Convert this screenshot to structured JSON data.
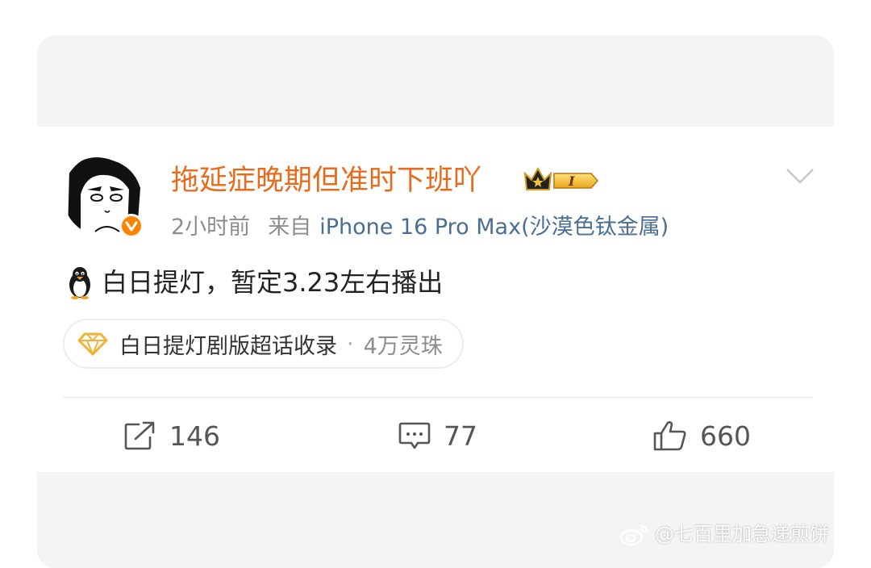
{
  "post": {
    "username": "拖延症晚期但准时下班吖",
    "vip_badge": "I",
    "time": "2小时前",
    "source_prefix": "来自",
    "device": "iPhone 16 Pro Max(沙漠色钛金属)",
    "content": "白日提灯，暂定3.23左右播出",
    "topic": {
      "name": "白日提灯剧版超话收录",
      "separator": "·",
      "count": "4万灵珠"
    }
  },
  "actions": {
    "repost_count": "146",
    "comment_count": "77",
    "like_count": "660"
  },
  "watermark": "@七百里加急递煎饼",
  "colors": {
    "username": "#e86b1c",
    "device": "#4a6d96",
    "verified": "#ff8200",
    "gem": "#f2b233"
  },
  "icons": [
    "penguin-icon",
    "verified-icon",
    "vip-crown-icon",
    "chevron-down-icon",
    "diamond-icon",
    "repost-icon",
    "comment-icon",
    "like-icon",
    "weibo-logo-icon"
  ]
}
